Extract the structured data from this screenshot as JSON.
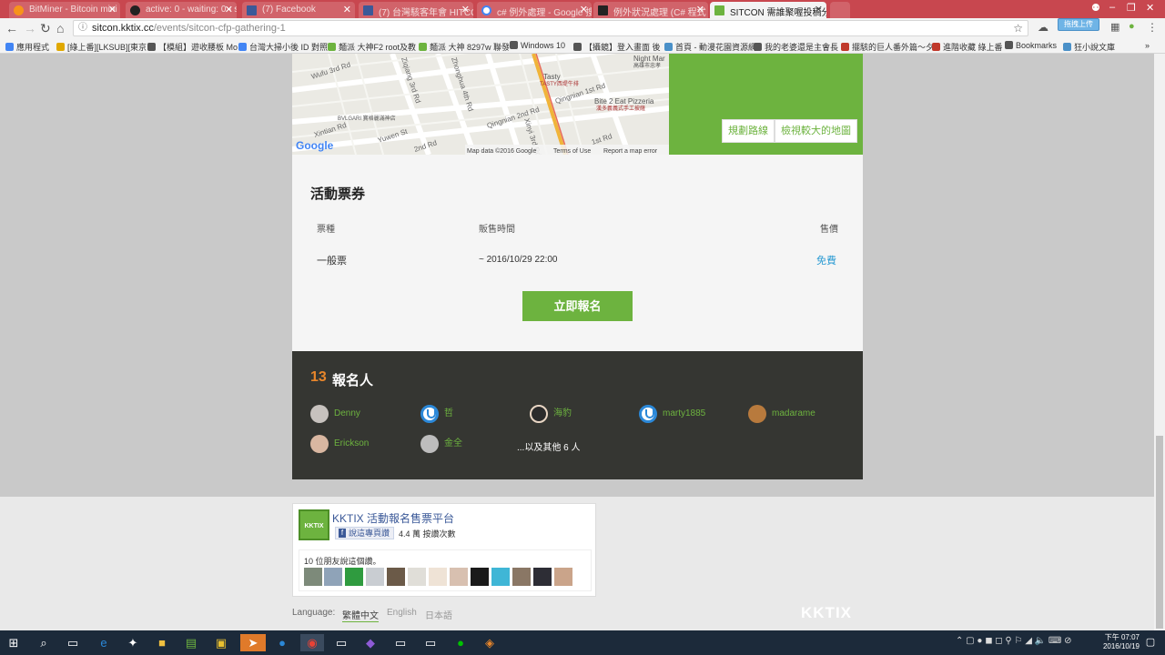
{
  "browser": {
    "tabs": [
      {
        "title": "BitMiner - Bitcoin mini",
        "color": "#f7931a"
      },
      {
        "title": "active: 0 - waiting: 0 - s",
        "color": "#222222"
      },
      {
        "title": "(7) Facebook",
        "color": "#3b5998"
      },
      {
        "title": "(7) 台灣駭客年會 HITCO",
        "color": "#3b5998"
      },
      {
        "title": "c# 例外處理 - Google 搜",
        "color": "#4285f4"
      },
      {
        "title": "例外狀況處理 (C# 程式",
        "color": "#222222"
      },
      {
        "title": "SITCON 需誰聚喔投稿分",
        "color": "#6db33f"
      }
    ],
    "url_host": "sitcon.kktix.cc",
    "url_path": "/events/sitcon-cfp-gathering-1",
    "upload_badge": "拖拽上传",
    "bookmarks": [
      {
        "label": "應用程式",
        "color": "#4285f4"
      },
      {
        "label": "[綠上番][LKSUB][東京",
        "color": "#e0a800"
      },
      {
        "label": "【模組】遊收腰板 Mo",
        "color": "#555555"
      },
      {
        "label": "台灣大掃小後 ID 對照",
        "color": "#4285f4"
      },
      {
        "label": "麵派 大神F2 root及教",
        "color": "#6db33f"
      },
      {
        "label": "麵派 大神 8297w 聯發",
        "color": "#6db33f"
      },
      {
        "label": "Windows 10",
        "color": "#555555"
      },
      {
        "label": "【攝鏡】登入畫面 後",
        "color": "#555555"
      },
      {
        "label": "首頁 - 動漫花園資源網",
        "color": "#4a90c8"
      },
      {
        "label": "我的老婆還是主會長",
        "color": "#555555"
      },
      {
        "label": "擺駭的巨人番外篇～夕",
        "color": "#c0392b"
      },
      {
        "label": "進階收藏 綠上番",
        "color": "#c0392b"
      },
      {
        "label": "Bookmarks",
        "color": "#555555"
      },
      {
        "label": "狂小說文庫",
        "color": "#4a90c8"
      }
    ]
  },
  "map": {
    "streets": [
      "Wufu 3rd Rd",
      "Ziqiang 3rd Rd",
      "Zhonghua 4th Rd",
      "Xinyi 3rd Rd",
      "Qingnian 1st Rd",
      "Qingnian 2nd Rd",
      "Yuwen St",
      "Xintian Rd",
      "2nd Rd",
      "1st Rd"
    ],
    "places": [
      "Tasty",
      "TASTY西堤牛排",
      "Bite 2 Eat Pizzeria",
      "漢多義義式手工披薩",
      "BVLGARI 寶格麗滿神店",
      "Night Mar",
      "高雄市忠孝"
    ],
    "logo": "Google",
    "credit": "Map data ©2016 Google",
    "terms": "Terms of Use",
    "report": "Report a map error",
    "route_button": "規劃路線",
    "larger_button": "檢視較大的地圖"
  },
  "tickets": {
    "title": "活動票券",
    "col_type": "票種",
    "col_period": "販售時間",
    "col_price": "售價",
    "rows": [
      {
        "type": "一般票",
        "period": "~ 2016/10/29 22:00",
        "price": "免費"
      }
    ],
    "register_button": "立即報名"
  },
  "attendees": {
    "count": "13",
    "label": "報名人",
    "people": [
      {
        "name": "Denny",
        "avatar": "photo"
      },
      {
        "name": "哲",
        "avatar": "power"
      },
      {
        "name": "海豹",
        "avatar": "photo"
      },
      {
        "name": "marty1885",
        "avatar": "power"
      },
      {
        "name": "madarame",
        "avatar": "photo"
      },
      {
        "name": "Erickson",
        "avatar": "photo"
      },
      {
        "name": "金全",
        "avatar": "photo"
      }
    ],
    "others": "...以及其他 6 人"
  },
  "facebook": {
    "page_name": "KKTIX 活動報名售票平台",
    "logo_text": "KKTIX",
    "like_label": "說這專頁讚",
    "like_count": "4.4 萬 按讚次數",
    "friends_text": "10 位朋友說這個讚。"
  },
  "footer": {
    "language_label": "Language:",
    "languages": [
      "繁體中文",
      "English",
      "日本語"
    ],
    "brand": "KKTIX"
  },
  "taskbar": {
    "time": "下午 07:07",
    "date": "2016/10/19"
  },
  "colors": {
    "accent": "#6db33f",
    "count": "#e8862b",
    "dark_panel": "#353632"
  }
}
